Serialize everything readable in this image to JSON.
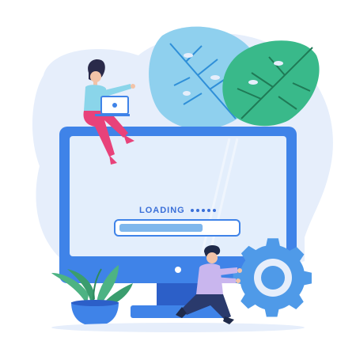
{
  "screen": {
    "loading_label": "LOADING",
    "loading_progress": 0.72
  },
  "colors": {
    "monitor_blue": "#3f83e8",
    "screen_fill": "#e3eefc",
    "blob_fill": "#e6eefb",
    "leaf_left": "#8fd0ee",
    "leaf_right": "#39b98a",
    "gear": "#4f9ae8",
    "progress_fill": "#7fb7ec",
    "woman_shirt": "#8ad5ea",
    "woman_pants": "#e8427a",
    "man_shirt": "#c9b6ee",
    "man_pants": "#2a3a6c",
    "plant": "#4db383",
    "pot": "#3f83e8"
  },
  "icons": {
    "left_leaf": "monstera-leaf-icon",
    "right_leaf": "monstera-leaf-icon",
    "gear": "gear-icon",
    "plant": "potted-plant-icon"
  }
}
